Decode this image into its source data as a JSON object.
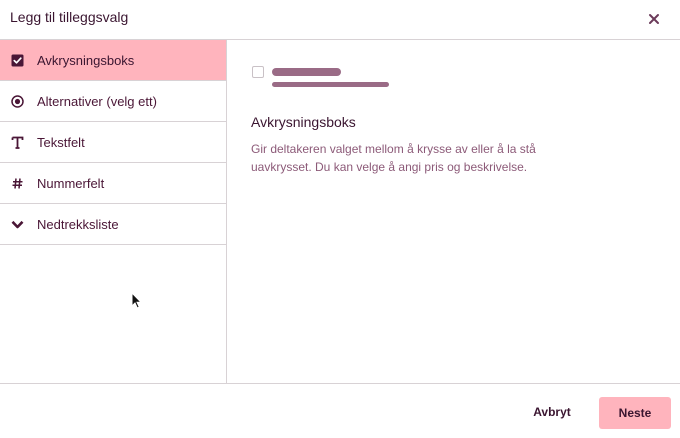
{
  "dialog": {
    "title": "Legg til tilleggsvalg",
    "close_icon": "close-icon"
  },
  "sidebar": {
    "items": [
      {
        "label": "Avkrysningsboks",
        "icon": "checkbox-icon",
        "selected": true
      },
      {
        "label": "Alternativer (velg ett)",
        "icon": "radio-icon",
        "selected": false
      },
      {
        "label": "Tekstfelt",
        "icon": "text-icon",
        "selected": false
      },
      {
        "label": "Nummerfelt",
        "icon": "hash-icon",
        "selected": false
      },
      {
        "label": "Nedtrekksliste",
        "icon": "chevron-down-icon",
        "selected": false
      }
    ]
  },
  "detail": {
    "title": "Avkrysningsboks",
    "description": "Gir deltakeren valget mellom å krysse av eller å la stå uavkrysset. Du kan velge å angi pris og beskrivelse."
  },
  "footer": {
    "cancel_label": "Avbryt",
    "next_label": "Neste"
  },
  "colors": {
    "accent": "#ffb4bd",
    "text_dark": "#3a1530",
    "text_muted": "#8c5a78",
    "border": "#d8d2d5"
  }
}
